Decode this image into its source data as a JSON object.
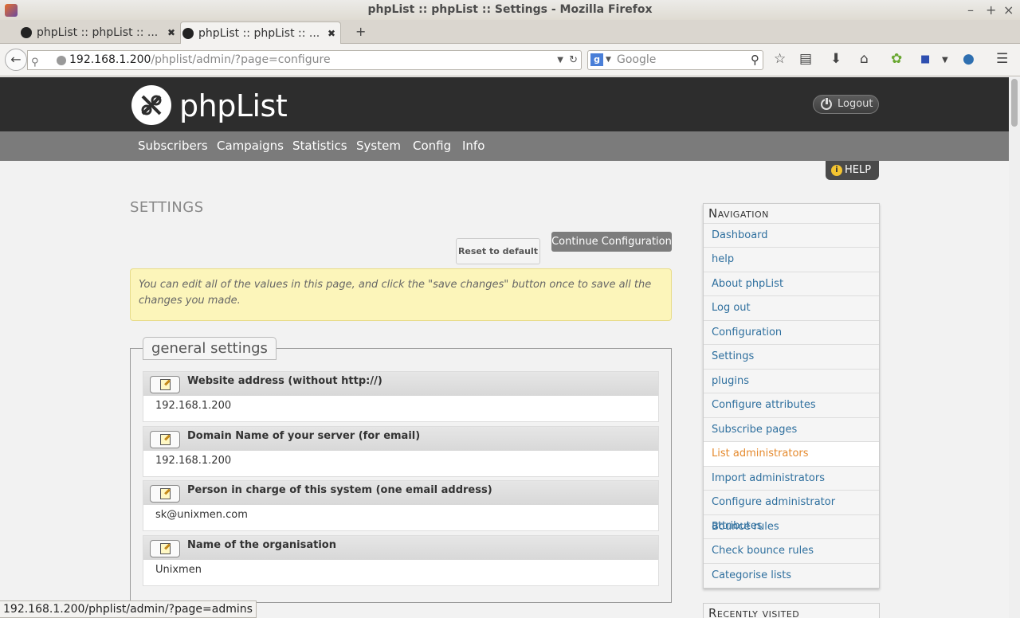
{
  "browser": {
    "window_title": "phpList :: phpList :: Settings - Mozilla Firefox",
    "tabs": [
      {
        "label": "phpList :: phpList :: ..."
      },
      {
        "label": "phpList :: phpList :: ..."
      }
    ],
    "url_host": "192.168.1.200",
    "url_path": "/phplist/admin/?page=configure",
    "search_placeholder": "Google",
    "status_url": "192.168.1.200/phplist/admin/?page=admins"
  },
  "header": {
    "logo_text": "phpList",
    "logout_label": "Logout",
    "help_label": "HELP"
  },
  "menu": [
    "Subscribers",
    "Campaigns",
    "Statistics",
    "System",
    "Config",
    "Info"
  ],
  "main": {
    "title": "SETTINGS",
    "reset_button": "Reset to default",
    "continue_button": "Continue Configuration",
    "info_text": "You can edit all of the values in this page, and click the \"save changes\" button once to save all the changes you made.",
    "section_title": "general settings",
    "settings": [
      {
        "label": "Website address (without http://)",
        "value": "192.168.1.200"
      },
      {
        "label": "Domain Name of your server (for email)",
        "value": "192.168.1.200"
      },
      {
        "label": "Person in charge of this system (one email address)",
        "value": "sk@unixmen.com"
      },
      {
        "label": "Name of the organisation",
        "value": "Unixmen"
      }
    ]
  },
  "navigation": {
    "title": "Navigation",
    "active_item": "List administrators",
    "items": [
      "Dashboard",
      "help",
      "About phpList",
      "Log out",
      "Configuration",
      "Settings",
      "plugins",
      "Configure attributes",
      "Subscribe pages",
      "List administrators",
      "Import administrators",
      "Configure administrator attributes",
      "Bounce rules",
      "Check bounce rules",
      "Categorise lists"
    ]
  },
  "recently_visited": {
    "title": "Recently visited"
  }
}
